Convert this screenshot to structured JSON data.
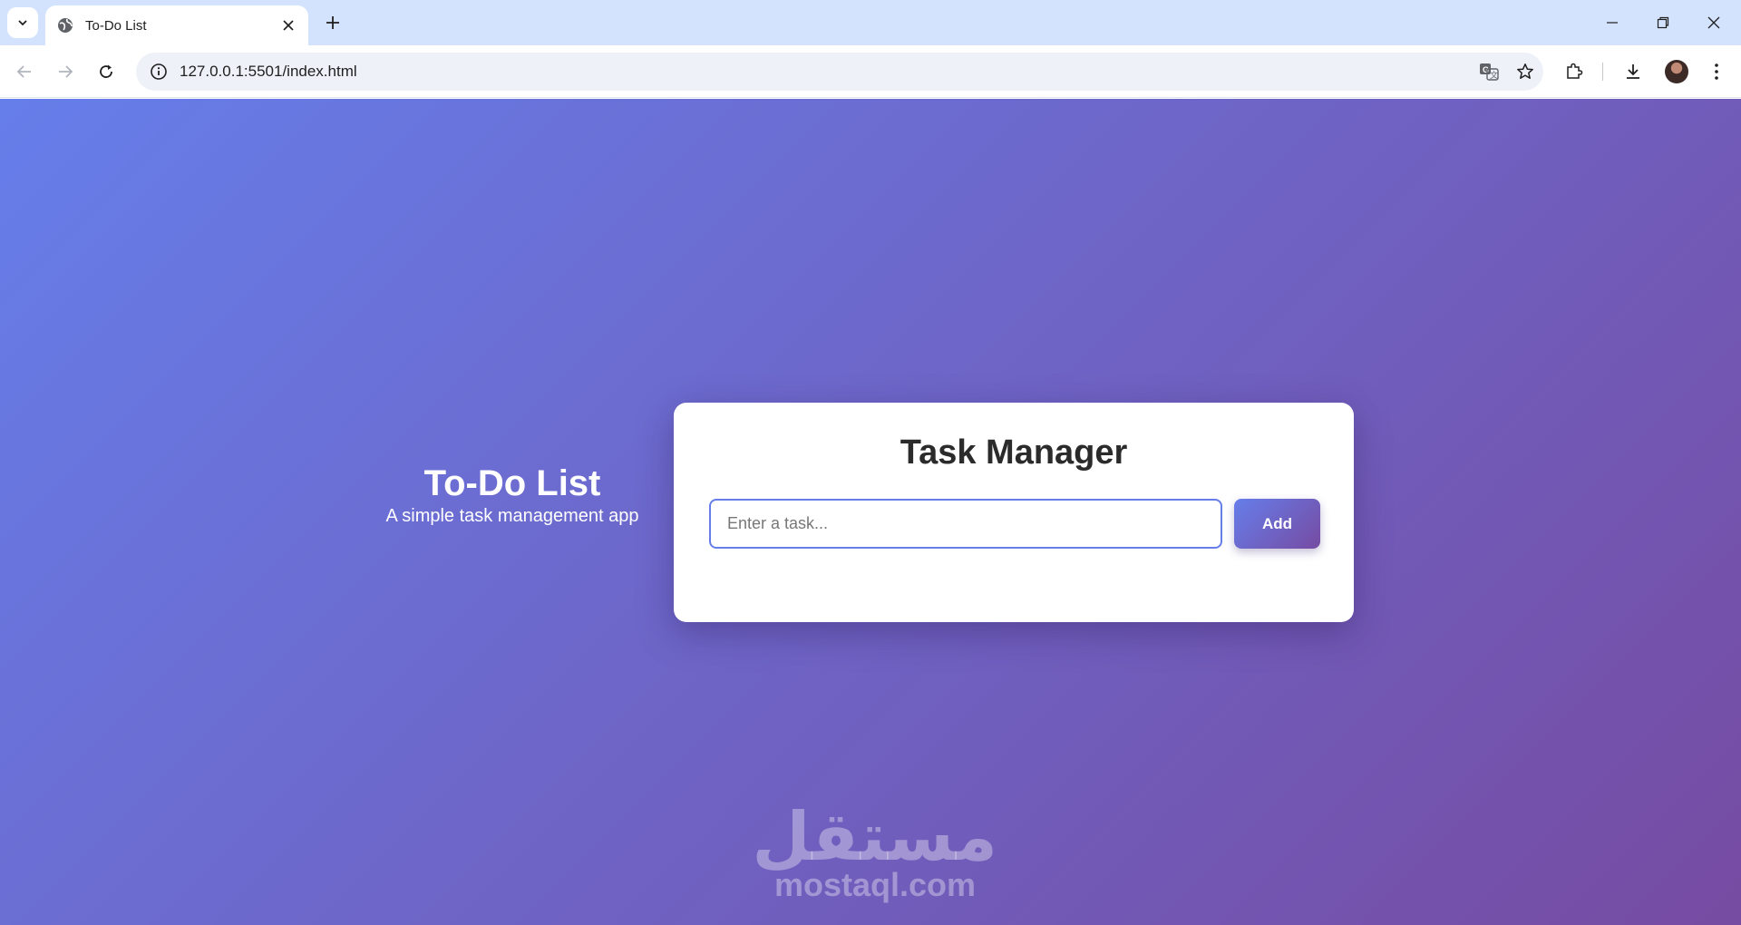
{
  "browser": {
    "tab_title": "To-Do List",
    "url": "127.0.0.1:5501/index.html",
    "icons": {
      "tab_search": "chevron-down-icon",
      "favicon": "globe-icon",
      "tab_close": "close-icon",
      "new_tab": "plus-icon",
      "minimize": "minimize-icon",
      "restore": "restore-icon",
      "window_close": "close-icon",
      "back": "arrow-left-icon",
      "forward": "arrow-right-icon",
      "reload": "reload-icon",
      "site_info": "info-icon",
      "translate": "translate-icon",
      "bookmark": "star-icon",
      "extensions": "puzzle-icon",
      "downloads": "download-icon",
      "profile": "avatar",
      "menu": "more-vertical-icon"
    }
  },
  "hero": {
    "title": "To-Do List",
    "subtitle": "A simple task management app"
  },
  "card": {
    "title": "Task Manager",
    "input_placeholder": "Enter a task...",
    "input_value": "",
    "add_label": "Add"
  },
  "watermark": {
    "arabic": "مستقل",
    "latin": "mostaql.com"
  },
  "colors": {
    "gradient_start": "#667eea",
    "gradient_end": "#764ba2",
    "tab_strip": "#d3e3fd"
  }
}
